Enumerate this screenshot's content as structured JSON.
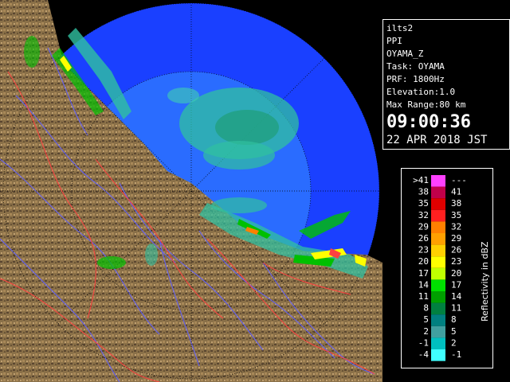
{
  "info": {
    "lines": [
      "ilts2",
      "PPI",
      "OYAMA_Z",
      "Task: OYAMA",
      "PRF: 1800Hz",
      "Elevation:1.0",
      "Max Range:80 km"
    ],
    "time": "09:00:36",
    "date": "22 APR 2018 JST"
  },
  "legend": {
    "unit_label": "Reflectivity in dBZ",
    "rows": [
      {
        "low": ">41",
        "high": "---",
        "color": "#ff40ff"
      },
      {
        "low": "38",
        "high": "41",
        "color": "#c0004a"
      },
      {
        "low": "35",
        "high": "38",
        "color": "#e00000"
      },
      {
        "low": "32",
        "high": "35",
        "color": "#ff2020"
      },
      {
        "low": "29",
        "high": "32",
        "color": "#ff8000"
      },
      {
        "low": "26",
        "high": "29",
        "color": "#ffa000"
      },
      {
        "low": "23",
        "high": "26",
        "color": "#ffd000"
      },
      {
        "low": "20",
        "high": "23",
        "color": "#ffff00"
      },
      {
        "low": "17",
        "high": "20",
        "color": "#c0ff00"
      },
      {
        "low": "14",
        "high": "17",
        "color": "#00e000"
      },
      {
        "low": "11",
        "high": "14",
        "color": "#00a000"
      },
      {
        "low": "8",
        "high": "11",
        "color": "#008040"
      },
      {
        "low": "5",
        "high": "8",
        "color": "#008080"
      },
      {
        "low": "2",
        "high": "5",
        "color": "#40a0a0"
      },
      {
        "low": "-1",
        "high": "2",
        "color": "#00c0c0"
      },
      {
        "low": "-4",
        "high": "-1",
        "color": "#40ffff"
      }
    ]
  },
  "colors": {
    "sea_outer": "#1a40ff",
    "sea_inner": "#2a6cff",
    "land": "#8a7048",
    "land_dark": "#4a3a24",
    "rivers": "#6060ff",
    "borders": "#ff4040",
    "echo_light": "#30c0a0",
    "echo_green": "#00c000",
    "echo_yellow": "#ffff00"
  }
}
